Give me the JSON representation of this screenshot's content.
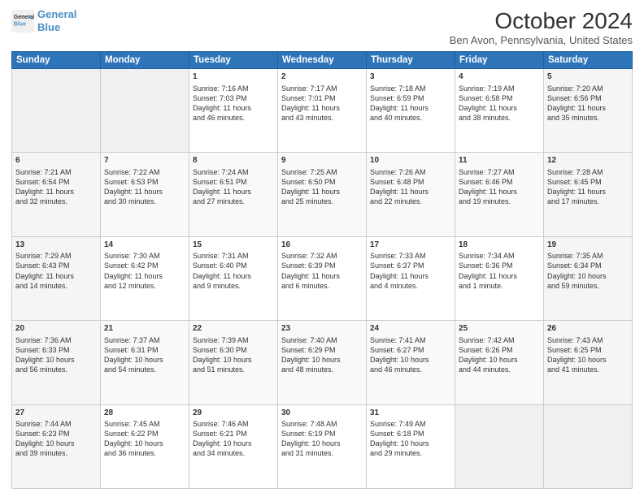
{
  "header": {
    "logo_line1": "General",
    "logo_line2": "Blue",
    "month": "October 2024",
    "location": "Ben Avon, Pennsylvania, United States"
  },
  "days_of_week": [
    "Sunday",
    "Monday",
    "Tuesday",
    "Wednesday",
    "Thursday",
    "Friday",
    "Saturday"
  ],
  "weeks": [
    [
      {
        "day": "",
        "info": ""
      },
      {
        "day": "",
        "info": ""
      },
      {
        "day": "1",
        "info": "Sunrise: 7:16 AM\nSunset: 7:03 PM\nDaylight: 11 hours\nand 46 minutes."
      },
      {
        "day": "2",
        "info": "Sunrise: 7:17 AM\nSunset: 7:01 PM\nDaylight: 11 hours\nand 43 minutes."
      },
      {
        "day": "3",
        "info": "Sunrise: 7:18 AM\nSunset: 6:59 PM\nDaylight: 11 hours\nand 40 minutes."
      },
      {
        "day": "4",
        "info": "Sunrise: 7:19 AM\nSunset: 6:58 PM\nDaylight: 11 hours\nand 38 minutes."
      },
      {
        "day": "5",
        "info": "Sunrise: 7:20 AM\nSunset: 6:56 PM\nDaylight: 11 hours\nand 35 minutes."
      }
    ],
    [
      {
        "day": "6",
        "info": "Sunrise: 7:21 AM\nSunset: 6:54 PM\nDaylight: 11 hours\nand 32 minutes."
      },
      {
        "day": "7",
        "info": "Sunrise: 7:22 AM\nSunset: 6:53 PM\nDaylight: 11 hours\nand 30 minutes."
      },
      {
        "day": "8",
        "info": "Sunrise: 7:24 AM\nSunset: 6:51 PM\nDaylight: 11 hours\nand 27 minutes."
      },
      {
        "day": "9",
        "info": "Sunrise: 7:25 AM\nSunset: 6:50 PM\nDaylight: 11 hours\nand 25 minutes."
      },
      {
        "day": "10",
        "info": "Sunrise: 7:26 AM\nSunset: 6:48 PM\nDaylight: 11 hours\nand 22 minutes."
      },
      {
        "day": "11",
        "info": "Sunrise: 7:27 AM\nSunset: 6:46 PM\nDaylight: 11 hours\nand 19 minutes."
      },
      {
        "day": "12",
        "info": "Sunrise: 7:28 AM\nSunset: 6:45 PM\nDaylight: 11 hours\nand 17 minutes."
      }
    ],
    [
      {
        "day": "13",
        "info": "Sunrise: 7:29 AM\nSunset: 6:43 PM\nDaylight: 11 hours\nand 14 minutes."
      },
      {
        "day": "14",
        "info": "Sunrise: 7:30 AM\nSunset: 6:42 PM\nDaylight: 11 hours\nand 12 minutes."
      },
      {
        "day": "15",
        "info": "Sunrise: 7:31 AM\nSunset: 6:40 PM\nDaylight: 11 hours\nand 9 minutes."
      },
      {
        "day": "16",
        "info": "Sunrise: 7:32 AM\nSunset: 6:39 PM\nDaylight: 11 hours\nand 6 minutes."
      },
      {
        "day": "17",
        "info": "Sunrise: 7:33 AM\nSunset: 6:37 PM\nDaylight: 11 hours\nand 4 minutes."
      },
      {
        "day": "18",
        "info": "Sunrise: 7:34 AM\nSunset: 6:36 PM\nDaylight: 11 hours\nand 1 minute."
      },
      {
        "day": "19",
        "info": "Sunrise: 7:35 AM\nSunset: 6:34 PM\nDaylight: 10 hours\nand 59 minutes."
      }
    ],
    [
      {
        "day": "20",
        "info": "Sunrise: 7:36 AM\nSunset: 6:33 PM\nDaylight: 10 hours\nand 56 minutes."
      },
      {
        "day": "21",
        "info": "Sunrise: 7:37 AM\nSunset: 6:31 PM\nDaylight: 10 hours\nand 54 minutes."
      },
      {
        "day": "22",
        "info": "Sunrise: 7:39 AM\nSunset: 6:30 PM\nDaylight: 10 hours\nand 51 minutes."
      },
      {
        "day": "23",
        "info": "Sunrise: 7:40 AM\nSunset: 6:29 PM\nDaylight: 10 hours\nand 48 minutes."
      },
      {
        "day": "24",
        "info": "Sunrise: 7:41 AM\nSunset: 6:27 PM\nDaylight: 10 hours\nand 46 minutes."
      },
      {
        "day": "25",
        "info": "Sunrise: 7:42 AM\nSunset: 6:26 PM\nDaylight: 10 hours\nand 44 minutes."
      },
      {
        "day": "26",
        "info": "Sunrise: 7:43 AM\nSunset: 6:25 PM\nDaylight: 10 hours\nand 41 minutes."
      }
    ],
    [
      {
        "day": "27",
        "info": "Sunrise: 7:44 AM\nSunset: 6:23 PM\nDaylight: 10 hours\nand 39 minutes."
      },
      {
        "day": "28",
        "info": "Sunrise: 7:45 AM\nSunset: 6:22 PM\nDaylight: 10 hours\nand 36 minutes."
      },
      {
        "day": "29",
        "info": "Sunrise: 7:46 AM\nSunset: 6:21 PM\nDaylight: 10 hours\nand 34 minutes."
      },
      {
        "day": "30",
        "info": "Sunrise: 7:48 AM\nSunset: 6:19 PM\nDaylight: 10 hours\nand 31 minutes."
      },
      {
        "day": "31",
        "info": "Sunrise: 7:49 AM\nSunset: 6:18 PM\nDaylight: 10 hours\nand 29 minutes."
      },
      {
        "day": "",
        "info": ""
      },
      {
        "day": "",
        "info": ""
      }
    ]
  ]
}
